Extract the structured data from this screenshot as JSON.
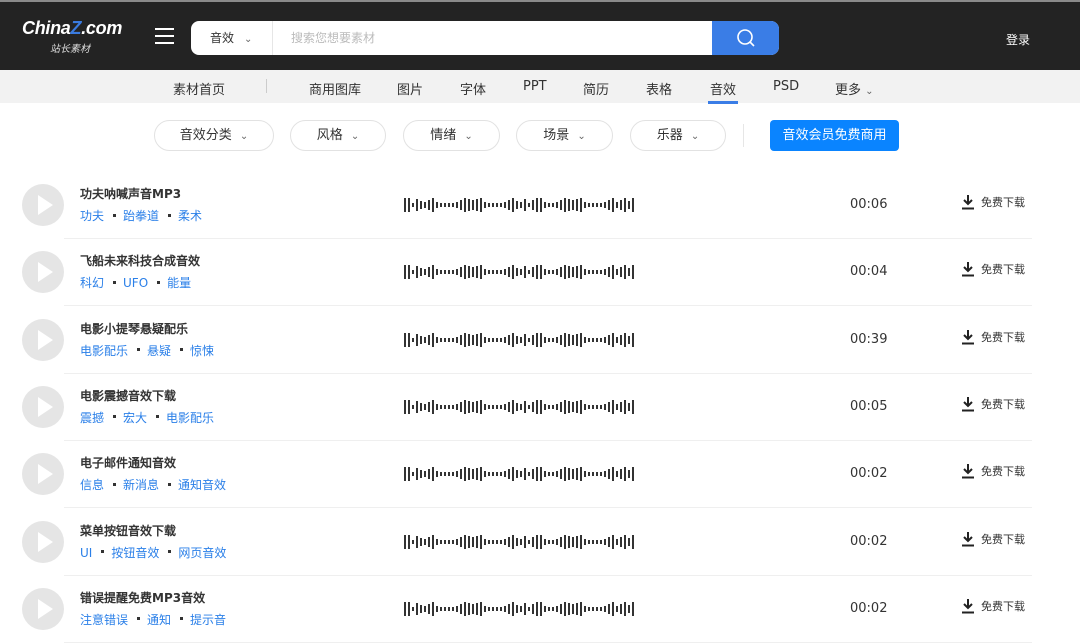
{
  "header": {
    "logo": "ChinaZ.com",
    "logo_sub": "站长素材",
    "search_category": "音效",
    "search_placeholder": "搜索您想要素材",
    "login": "登录"
  },
  "nav": {
    "items": [
      "素材首页",
      "商用图库",
      "图片",
      "字体",
      "PPT",
      "简历",
      "表格",
      "音效",
      "PSD",
      "更多"
    ],
    "active": "音效"
  },
  "filters": [
    "音效分类",
    "风格",
    "情绪",
    "场景",
    "乐器"
  ],
  "vip_button": "音效会员免费商用",
  "download_label": "免费下载",
  "sounds": [
    {
      "title": "功夫呐喊声音MP3",
      "tags": [
        "功夫",
        "跆拳道",
        "柔术"
      ],
      "duration": "00:06"
    },
    {
      "title": "飞船未来科技合成音效",
      "tags": [
        "科幻",
        "UFO",
        "能量"
      ],
      "duration": "00:04"
    },
    {
      "title": "电影小提琴悬疑配乐",
      "tags": [
        "电影配乐",
        "悬疑",
        "惊悚"
      ],
      "duration": "00:39"
    },
    {
      "title": "电影震撼音效下载",
      "tags": [
        "震撼",
        "宏大",
        "电影配乐"
      ],
      "duration": "00:05"
    },
    {
      "title": "电子邮件通知音效",
      "tags": [
        "信息",
        "新消息",
        "通知音效"
      ],
      "duration": "00:02"
    },
    {
      "title": "菜单按钮音效下载",
      "tags": [
        "UI",
        "按钮音效",
        "网页音效"
      ],
      "duration": "00:02"
    },
    {
      "title": "错误提醒免费MP3音效",
      "tags": [
        "注意错误",
        "通知",
        "提示音"
      ],
      "duration": "00:02"
    }
  ]
}
